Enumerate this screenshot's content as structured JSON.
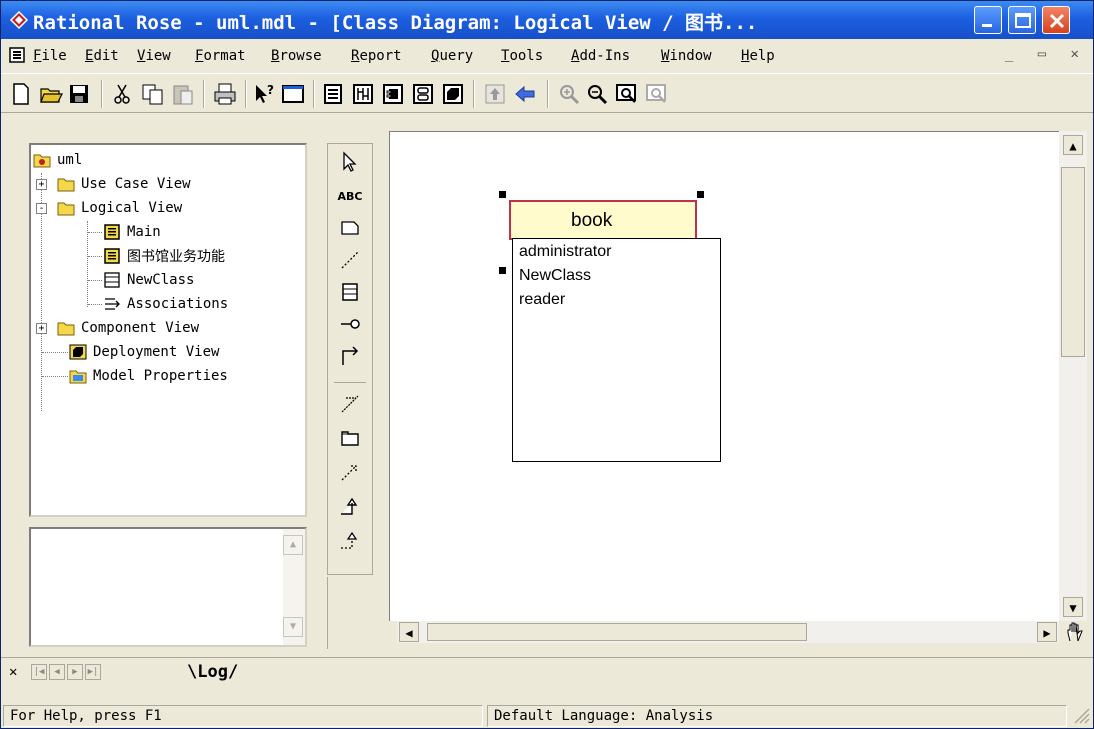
{
  "window": {
    "title": "Rational Rose - uml.mdl - [Class Diagram: Logical View / 图书...",
    "controls": {
      "minimize": "minimize",
      "maximize": "maximize",
      "close": "close"
    }
  },
  "menubar": {
    "items": [
      "File",
      "Edit",
      "View",
      "Format",
      "Browse",
      "Report",
      "Query",
      "Tools",
      "Add-Ins",
      "Window",
      "Help"
    ],
    "mdi_controls": "_ ▭ ✕"
  },
  "toolbar": {
    "icons": [
      "new-icon",
      "open-icon",
      "save-icon",
      "cut-icon",
      "copy-icon",
      "paste-icon",
      "print-icon",
      "context-help-icon",
      "view-doc-icon",
      "browse-class-diagram-icon",
      "browse-interaction-diagram-icon",
      "browse-component-diagram-icon",
      "browse-deployment-diagram-icon",
      "browse-parent-icon",
      "browse-previous-icon",
      "zoom-in-icon",
      "zoom-out-icon",
      "fit-in-window-icon",
      "undo-fit-icon"
    ]
  },
  "browser": {
    "root": "uml",
    "items": [
      {
        "label": "Use Case View",
        "type": "folder",
        "expander": "+"
      },
      {
        "label": "Logical View",
        "type": "folder",
        "expander": "-"
      },
      {
        "label": "Main",
        "type": "diagram"
      },
      {
        "label": "图书馆业务功能",
        "type": "diagram"
      },
      {
        "label": "NewClass",
        "type": "class"
      },
      {
        "label": "Associations",
        "type": "associations"
      },
      {
        "label": "Component View",
        "type": "folder",
        "expander": "+"
      },
      {
        "label": "Deployment View",
        "type": "deployment"
      },
      {
        "label": "Model Properties",
        "type": "properties"
      }
    ]
  },
  "toolbox": {
    "text_tool_label": "ABC"
  },
  "diagram": {
    "class_name_value": "book",
    "dropdown_options": [
      "administrator",
      "NewClass",
      "reader"
    ]
  },
  "log": {
    "tab_label": "\\Log/"
  },
  "status": {
    "help": "For Help, press F1",
    "language": "Default Language: Analysis"
  },
  "colors": {
    "title_bar": "#1c5fe0",
    "class_fill": "#fffbcc",
    "class_border": "#c0324a",
    "folder_yellow": "#f5d84a"
  }
}
